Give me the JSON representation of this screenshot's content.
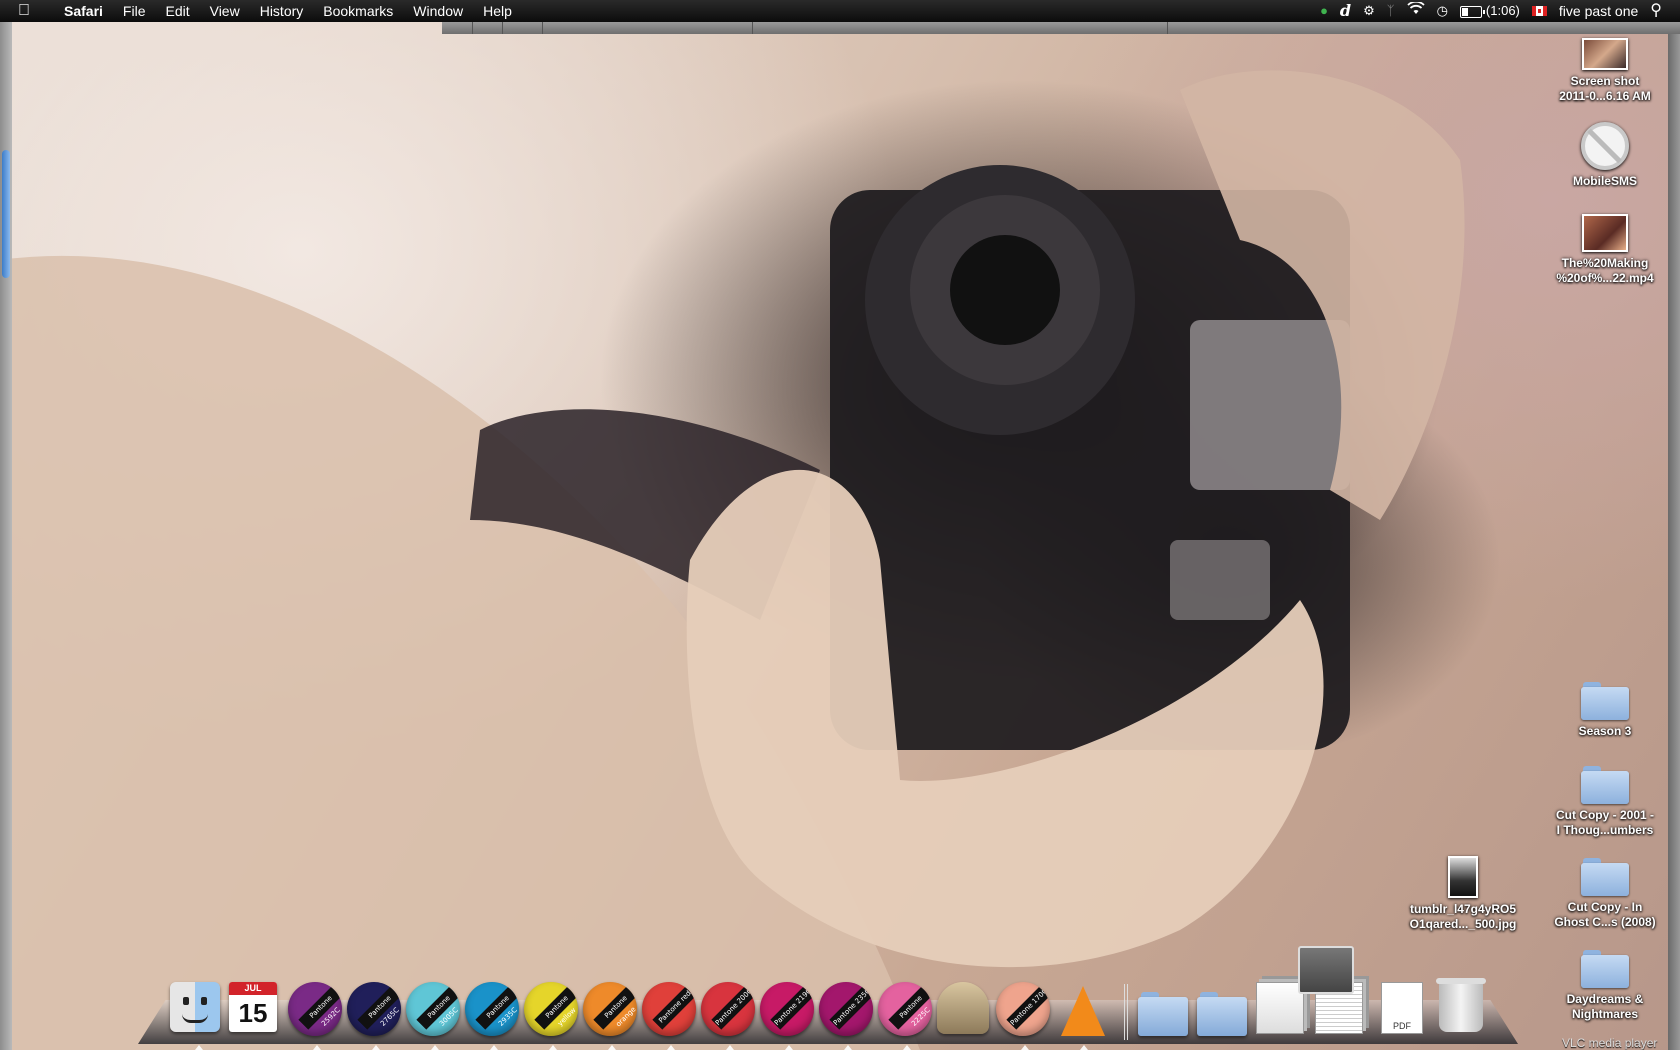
{
  "menubar": {
    "apple": "",
    "app_name": "Safari",
    "menus": [
      "File",
      "Edit",
      "View",
      "History",
      "Bookmarks",
      "Window",
      "Help"
    ],
    "status": {
      "evernote": "evernote-icon",
      "dictionary": "d",
      "gear": "gear-icon",
      "bluetooth": "bluetooth-icon",
      "wifi": "wifi-icon",
      "time_machine": "time-machine-icon",
      "battery_time": "(1:06)",
      "battery_level": 0.35,
      "clock": "five past one",
      "spotlight": "search-icon"
    },
    "colors": {
      "bar": "#111111",
      "text": "#ffffff"
    }
  },
  "desktop_icons": [
    {
      "name": "Screen shot",
      "label_line1": "Screen shot",
      "label_line2": "2011-0...6.16 AM",
      "kind": "screenshot"
    },
    {
      "name": "MobileSMS",
      "label_line1": "MobileSMS",
      "label_line2": "",
      "kind": "app"
    },
    {
      "name": "The%20Making",
      "label_line1": "The%20Making",
      "label_line2": "%20of%...22.mp4",
      "kind": "video"
    },
    {
      "name": "Season 3",
      "label_line1": "Season 3",
      "label_line2": "",
      "kind": "folder"
    },
    {
      "name": "Cut Copy 2001",
      "label_line1": "Cut Copy - 2001 -",
      "label_line2": "I Thoug...umbers",
      "kind": "folder"
    },
    {
      "name": "tumblr",
      "label_line1": "tumblr_l47g4yRO5",
      "label_line2": "O1qared..._500.jpg",
      "kind": "image"
    },
    {
      "name": "Cut Copy In Ghost",
      "label_line1": "Cut Copy - In",
      "label_line2": "Ghost C...s (2008)",
      "kind": "folder"
    },
    {
      "name": "Daydreams",
      "label_line1": "Daydreams &",
      "label_line2": "Nightmares",
      "kind": "folder"
    }
  ],
  "dock": {
    "calendar": {
      "month": "JUL",
      "day": "15"
    },
    "pantone_apps": [
      {
        "label": "Pantone 2592C",
        "color": "#7a2a86"
      },
      {
        "label": "Pantone 2765C",
        "color": "#201f5a"
      },
      {
        "label": "Pantone 3005C",
        "color": "#5fc6d6"
      },
      {
        "label": "Pantone 2935C",
        "color": "#1a92c9"
      },
      {
        "label": "Pantone yellow",
        "color": "#e5d52a"
      },
      {
        "label": "Pantone orange",
        "color": "#ee8a2a"
      },
      {
        "label": "Pantone red",
        "color": "#e0403a"
      },
      {
        "label": "Pantone 200C",
        "color": "#d8343e"
      },
      {
        "label": "Pantone 219C",
        "color": "#c71a66"
      },
      {
        "label": "Pantone 235C",
        "color": "#a3176c"
      },
      {
        "label": "Pantone 2225C",
        "color": "#e4629f"
      }
    ],
    "extra_pantone": {
      "label": "Pantone 170C",
      "color": "#efa48d"
    },
    "pdf_label": "PDF",
    "vlc_tooltip": "VLC media player"
  }
}
